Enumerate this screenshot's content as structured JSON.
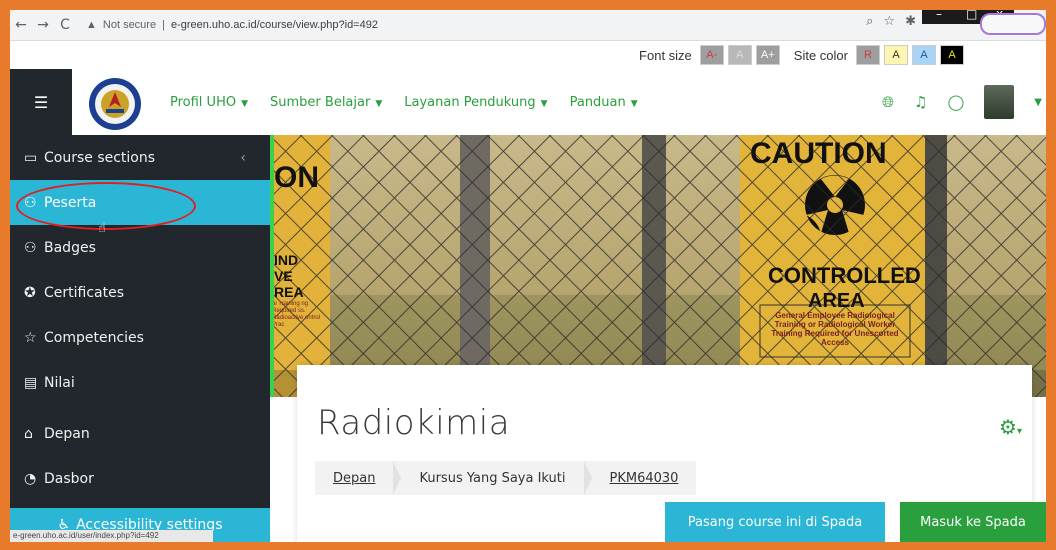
{
  "browser": {
    "back": "←",
    "forward": "→",
    "reload": "C",
    "security": "Not secure",
    "separator": "|",
    "url": "e-green.uho.ac.id/course/view.php?id=492",
    "window_min": "–",
    "window_max": "□",
    "window_close": "x"
  },
  "accessibility_bar": {
    "font_size_label": "Font size",
    "font_buttons": [
      "A-",
      "A",
      "A+"
    ],
    "site_color_label": "Site color",
    "color_buttons": [
      {
        "label": "R",
        "bg": "#9e9e9e",
        "fg": "#c94040"
      },
      {
        "label": "A",
        "bg": "#fff5b3",
        "fg": "#333333"
      },
      {
        "label": "A",
        "bg": "#a9d4f5",
        "fg": "#1e5a96"
      },
      {
        "label": "A",
        "bg": "#000000",
        "fg": "#f5e600"
      }
    ]
  },
  "navbar": {
    "menu": [
      "Profil UHO",
      "Sumber Belajar",
      "Layanan Pendukung",
      "Panduan"
    ],
    "accent": "#2a9f3d"
  },
  "sidebar": {
    "items": [
      {
        "label": "Course sections",
        "icon": "folder-icon"
      },
      {
        "label": "Peserta",
        "icon": "users-icon",
        "active": true
      },
      {
        "label": "Badges",
        "icon": "badge-icon"
      },
      {
        "label": "Certificates",
        "icon": "certificate-icon"
      },
      {
        "label": "Competencies",
        "icon": "star-icon"
      },
      {
        "label": "Nilai",
        "icon": "table-icon"
      },
      {
        "label": "Depan",
        "icon": "home-icon"
      },
      {
        "label": "Dasbor",
        "icon": "dashboard-icon"
      }
    ],
    "accessibility_settings": "Accessibility settings",
    "status_url": "e-green.uho.ac.id/user/index.php?id=492"
  },
  "banner": {
    "sign_caution": "CAUTION",
    "sign_controlled": "CONTROLLED",
    "sign_area": "AREA",
    "sign_fine": "General Employee Radiological Training or Radiological Worker Training Required for Unescorted Access",
    "left_sign_partial": "ON",
    "left_sign_lines": [
      "IND",
      "VE",
      "REA"
    ],
    "left_sign_fine": "al Training ng Required ss. Radioactive ontrol Prac"
  },
  "course": {
    "title": "Radiokimia",
    "breadcrumb": [
      "Depan",
      "Kursus Yang Saya Ikuti",
      "PKM64030"
    ],
    "btn_spada": "Pasang course ini di Spada",
    "btn_masuk": "Masuk ke Spada"
  }
}
